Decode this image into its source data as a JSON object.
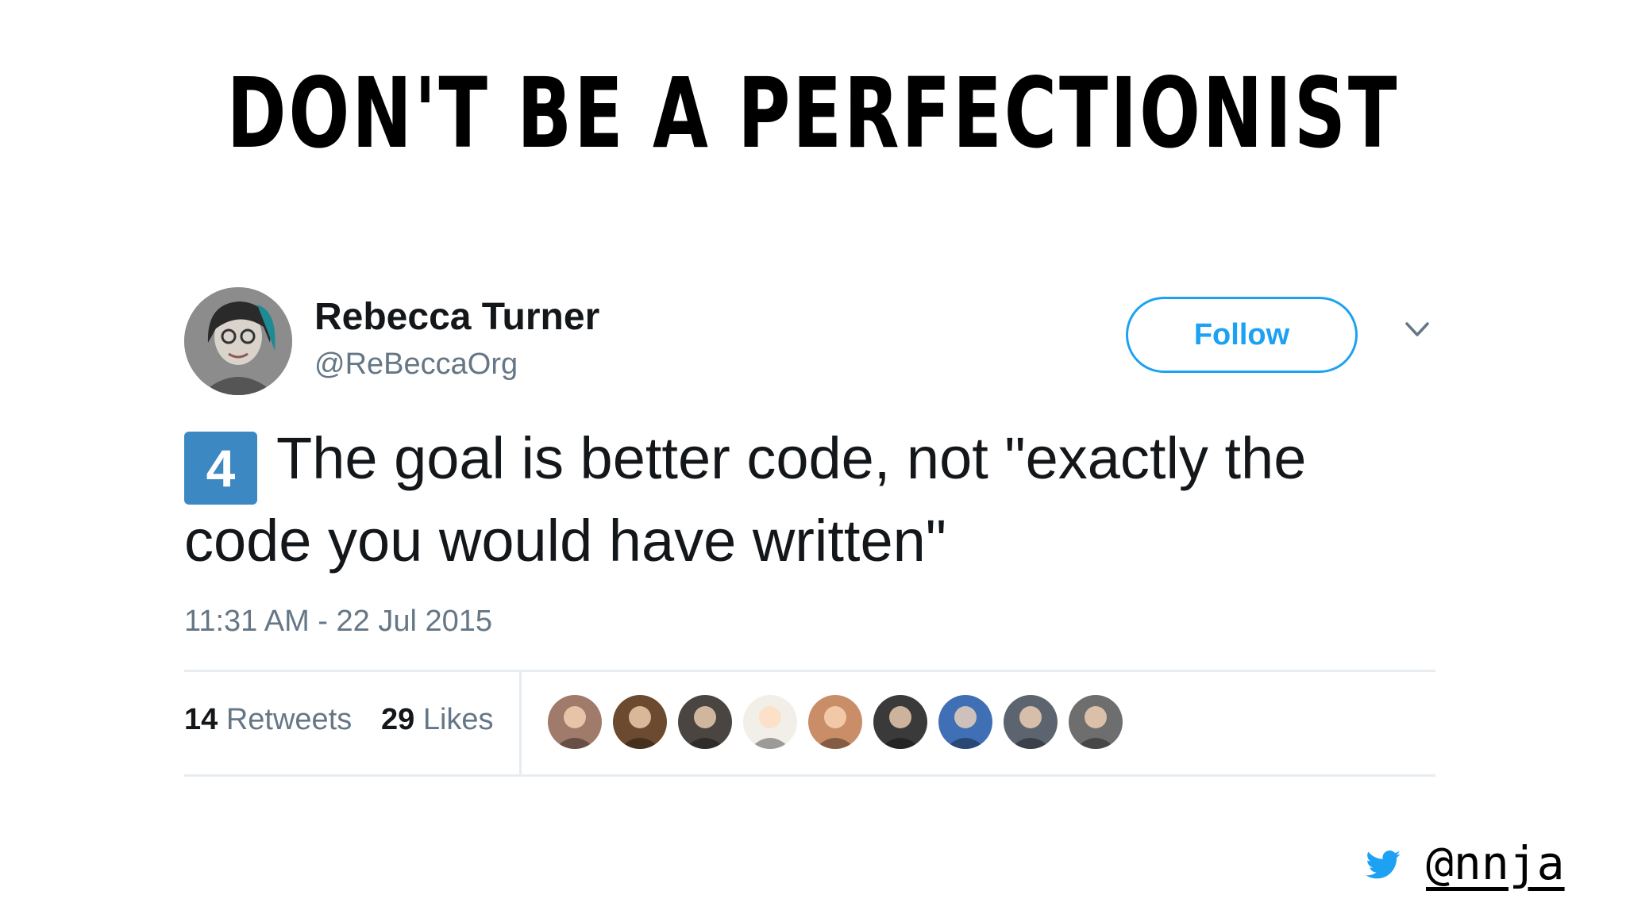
{
  "slide": {
    "title": "DON'T BE A PERFECTIONIST",
    "footer_handle": "@nnja",
    "footer_icon": "twitter-bird-icon",
    "accent": "#1da1f2"
  },
  "tweet": {
    "author": {
      "display_name": "Rebecca Turner",
      "handle": "@ReBeccaOrg",
      "avatar_icon": "avatar-photo"
    },
    "follow_label": "Follow",
    "menu_icon": "chevron-down-icon",
    "number_emoji": "4",
    "text": "The goal is better code, not \"exactly the code you would have written\"",
    "timestamp": "11:31 AM - 22 Jul 2015",
    "stats": {
      "retweets_count": "14",
      "retweets_label": "Retweets",
      "likes_count": "29",
      "likes_label": "Likes"
    },
    "likers": [
      {
        "name": "liker-avatar-1",
        "color": "#a07a6a"
      },
      {
        "name": "liker-avatar-2",
        "color": "#6b4a2f"
      },
      {
        "name": "liker-avatar-3",
        "color": "#4a4540"
      },
      {
        "name": "liker-avatar-4",
        "color": "#f2efe8"
      },
      {
        "name": "liker-avatar-5",
        "color": "#c98e68"
      },
      {
        "name": "liker-avatar-6",
        "color": "#3a3a3a"
      },
      {
        "name": "liker-avatar-7",
        "color": "#3f6fb4"
      },
      {
        "name": "liker-avatar-8",
        "color": "#5c6470"
      },
      {
        "name": "liker-avatar-9",
        "color": "#6e6e6e"
      }
    ]
  }
}
